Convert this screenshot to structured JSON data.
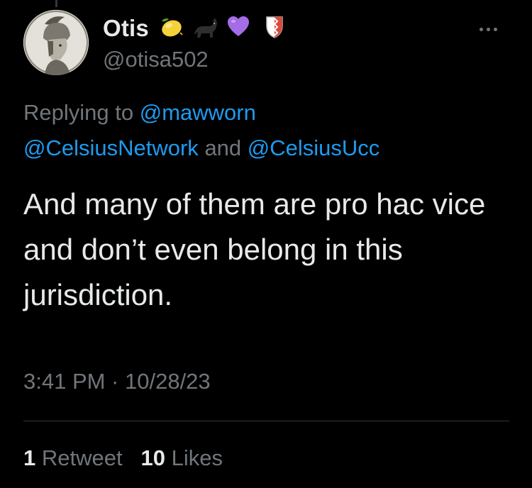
{
  "author": {
    "display_name": "Otis",
    "handle": "@otisa502",
    "name_emojis": [
      "lemon-emoji",
      "black-cat-emoji",
      "purple-heart-emoji",
      "shield-emoji"
    ]
  },
  "reply": {
    "prefix": "Replying to",
    "mention_1": "@mawworn",
    "mention_2": "@CelsiusNetwork",
    "conjunction": "and",
    "mention_3": "@CelsiusUcc"
  },
  "tweet": {
    "text": "And many of them are pro hac vice and don’t even belong in this jurisdiction.",
    "timestamp": "3:41 PM · 10/28/23"
  },
  "stats": {
    "retweet_count": "1",
    "retweet_label": "Retweet",
    "like_count": "10",
    "like_label": "Likes"
  },
  "colors": {
    "background": "#000000",
    "primary_text": "#e7e9ea",
    "secondary_text": "#71767b",
    "link": "#1d9bf0",
    "divider": "#2f3336"
  }
}
